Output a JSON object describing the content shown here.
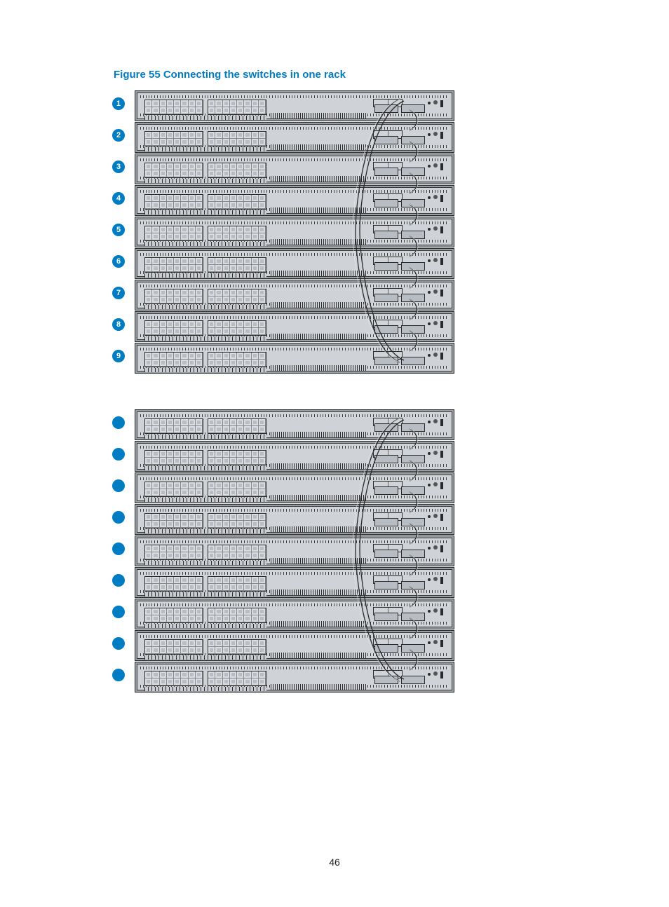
{
  "figure": {
    "caption": "Figure 55 Connecting the switches in one rack",
    "racks": [
      {
        "rows": [
          {
            "callout": "1"
          },
          {
            "callout": "2"
          },
          {
            "callout": "3"
          },
          {
            "callout": "4"
          },
          {
            "callout": "5"
          },
          {
            "callout": "6"
          },
          {
            "callout": "7"
          },
          {
            "callout": "8"
          },
          {
            "callout": "9"
          }
        ]
      },
      {
        "rows": [
          {
            "callout": ""
          },
          {
            "callout": ""
          },
          {
            "callout": ""
          },
          {
            "callout": ""
          },
          {
            "callout": ""
          },
          {
            "callout": ""
          },
          {
            "callout": ""
          },
          {
            "callout": ""
          },
          {
            "callout": ""
          }
        ]
      }
    ]
  },
  "page_number": "46"
}
